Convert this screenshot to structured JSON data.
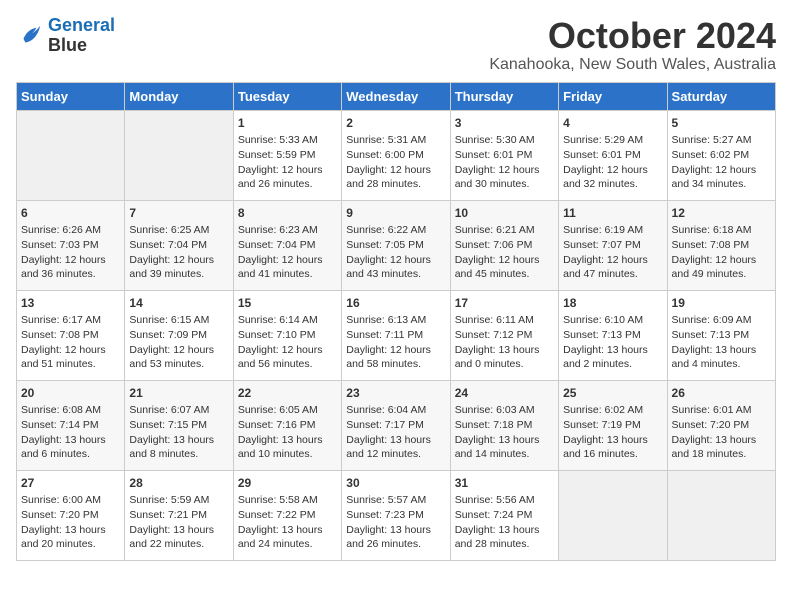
{
  "header": {
    "logo_line1": "General",
    "logo_line2": "Blue",
    "month": "October 2024",
    "location": "Kanahooka, New South Wales, Australia"
  },
  "weekdays": [
    "Sunday",
    "Monday",
    "Tuesday",
    "Wednesday",
    "Thursday",
    "Friday",
    "Saturday"
  ],
  "weeks": [
    [
      {
        "day": "",
        "empty": true
      },
      {
        "day": "",
        "empty": true
      },
      {
        "day": "1",
        "sunrise": "Sunrise: 5:33 AM",
        "sunset": "Sunset: 5:59 PM",
        "daylight": "Daylight: 12 hours and 26 minutes."
      },
      {
        "day": "2",
        "sunrise": "Sunrise: 5:31 AM",
        "sunset": "Sunset: 6:00 PM",
        "daylight": "Daylight: 12 hours and 28 minutes."
      },
      {
        "day": "3",
        "sunrise": "Sunrise: 5:30 AM",
        "sunset": "Sunset: 6:01 PM",
        "daylight": "Daylight: 12 hours and 30 minutes."
      },
      {
        "day": "4",
        "sunrise": "Sunrise: 5:29 AM",
        "sunset": "Sunset: 6:01 PM",
        "daylight": "Daylight: 12 hours and 32 minutes."
      },
      {
        "day": "5",
        "sunrise": "Sunrise: 5:27 AM",
        "sunset": "Sunset: 6:02 PM",
        "daylight": "Daylight: 12 hours and 34 minutes."
      }
    ],
    [
      {
        "day": "6",
        "sunrise": "Sunrise: 6:26 AM",
        "sunset": "Sunset: 7:03 PM",
        "daylight": "Daylight: 12 hours and 36 minutes."
      },
      {
        "day": "7",
        "sunrise": "Sunrise: 6:25 AM",
        "sunset": "Sunset: 7:04 PM",
        "daylight": "Daylight: 12 hours and 39 minutes."
      },
      {
        "day": "8",
        "sunrise": "Sunrise: 6:23 AM",
        "sunset": "Sunset: 7:04 PM",
        "daylight": "Daylight: 12 hours and 41 minutes."
      },
      {
        "day": "9",
        "sunrise": "Sunrise: 6:22 AM",
        "sunset": "Sunset: 7:05 PM",
        "daylight": "Daylight: 12 hours and 43 minutes."
      },
      {
        "day": "10",
        "sunrise": "Sunrise: 6:21 AM",
        "sunset": "Sunset: 7:06 PM",
        "daylight": "Daylight: 12 hours and 45 minutes."
      },
      {
        "day": "11",
        "sunrise": "Sunrise: 6:19 AM",
        "sunset": "Sunset: 7:07 PM",
        "daylight": "Daylight: 12 hours and 47 minutes."
      },
      {
        "day": "12",
        "sunrise": "Sunrise: 6:18 AM",
        "sunset": "Sunset: 7:08 PM",
        "daylight": "Daylight: 12 hours and 49 minutes."
      }
    ],
    [
      {
        "day": "13",
        "sunrise": "Sunrise: 6:17 AM",
        "sunset": "Sunset: 7:08 PM",
        "daylight": "Daylight: 12 hours and 51 minutes."
      },
      {
        "day": "14",
        "sunrise": "Sunrise: 6:15 AM",
        "sunset": "Sunset: 7:09 PM",
        "daylight": "Daylight: 12 hours and 53 minutes."
      },
      {
        "day": "15",
        "sunrise": "Sunrise: 6:14 AM",
        "sunset": "Sunset: 7:10 PM",
        "daylight": "Daylight: 12 hours and 56 minutes."
      },
      {
        "day": "16",
        "sunrise": "Sunrise: 6:13 AM",
        "sunset": "Sunset: 7:11 PM",
        "daylight": "Daylight: 12 hours and 58 minutes."
      },
      {
        "day": "17",
        "sunrise": "Sunrise: 6:11 AM",
        "sunset": "Sunset: 7:12 PM",
        "daylight": "Daylight: 13 hours and 0 minutes."
      },
      {
        "day": "18",
        "sunrise": "Sunrise: 6:10 AM",
        "sunset": "Sunset: 7:13 PM",
        "daylight": "Daylight: 13 hours and 2 minutes."
      },
      {
        "day": "19",
        "sunrise": "Sunrise: 6:09 AM",
        "sunset": "Sunset: 7:13 PM",
        "daylight": "Daylight: 13 hours and 4 minutes."
      }
    ],
    [
      {
        "day": "20",
        "sunrise": "Sunrise: 6:08 AM",
        "sunset": "Sunset: 7:14 PM",
        "daylight": "Daylight: 13 hours and 6 minutes."
      },
      {
        "day": "21",
        "sunrise": "Sunrise: 6:07 AM",
        "sunset": "Sunset: 7:15 PM",
        "daylight": "Daylight: 13 hours and 8 minutes."
      },
      {
        "day": "22",
        "sunrise": "Sunrise: 6:05 AM",
        "sunset": "Sunset: 7:16 PM",
        "daylight": "Daylight: 13 hours and 10 minutes."
      },
      {
        "day": "23",
        "sunrise": "Sunrise: 6:04 AM",
        "sunset": "Sunset: 7:17 PM",
        "daylight": "Daylight: 13 hours and 12 minutes."
      },
      {
        "day": "24",
        "sunrise": "Sunrise: 6:03 AM",
        "sunset": "Sunset: 7:18 PM",
        "daylight": "Daylight: 13 hours and 14 minutes."
      },
      {
        "day": "25",
        "sunrise": "Sunrise: 6:02 AM",
        "sunset": "Sunset: 7:19 PM",
        "daylight": "Daylight: 13 hours and 16 minutes."
      },
      {
        "day": "26",
        "sunrise": "Sunrise: 6:01 AM",
        "sunset": "Sunset: 7:20 PM",
        "daylight": "Daylight: 13 hours and 18 minutes."
      }
    ],
    [
      {
        "day": "27",
        "sunrise": "Sunrise: 6:00 AM",
        "sunset": "Sunset: 7:20 PM",
        "daylight": "Daylight: 13 hours and 20 minutes."
      },
      {
        "day": "28",
        "sunrise": "Sunrise: 5:59 AM",
        "sunset": "Sunset: 7:21 PM",
        "daylight": "Daylight: 13 hours and 22 minutes."
      },
      {
        "day": "29",
        "sunrise": "Sunrise: 5:58 AM",
        "sunset": "Sunset: 7:22 PM",
        "daylight": "Daylight: 13 hours and 24 minutes."
      },
      {
        "day": "30",
        "sunrise": "Sunrise: 5:57 AM",
        "sunset": "Sunset: 7:23 PM",
        "daylight": "Daylight: 13 hours and 26 minutes."
      },
      {
        "day": "31",
        "sunrise": "Sunrise: 5:56 AM",
        "sunset": "Sunset: 7:24 PM",
        "daylight": "Daylight: 13 hours and 28 minutes."
      },
      {
        "day": "",
        "empty": true
      },
      {
        "day": "",
        "empty": true
      }
    ]
  ]
}
